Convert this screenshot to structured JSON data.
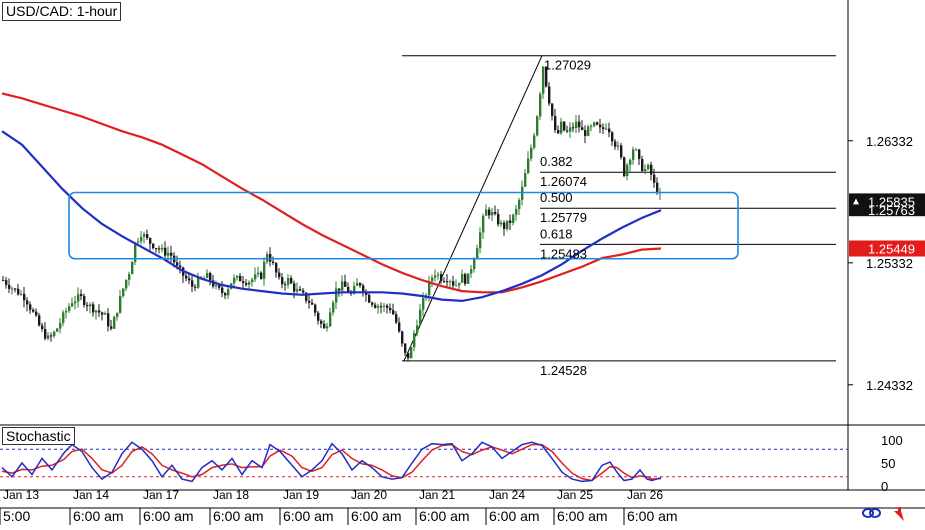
{
  "window": {
    "title": "USD/CAD: 1-hour"
  },
  "stochastic_label": "Stochastic",
  "colors": {
    "candle_up": "#2e7d2e",
    "candle_down": "#1a1a1a",
    "ma_fast": "#1f2fc4",
    "ma_slow": "#e02020",
    "zone": "#1e88e5",
    "price_tag": "#e21b1b",
    "stoch_k": "#1f2fc4",
    "stoch_d": "#e02020",
    "stoch_levels": "#1f2fc4"
  },
  "chart_data": [
    {
      "type": "candlestick",
      "title": "USD/CAD: 1-hour",
      "ylim": [
        1.2406,
        1.2742
      ],
      "y_ticks": [
        "1.26332",
        "1.25332",
        "1.24332"
      ],
      "price_tags": [
        {
          "label": "1.25835",
          "style": "dark",
          "value": 1.25835
        },
        {
          "label": "1.25763",
          "style": "dark-partial",
          "value": 1.25763
        },
        {
          "label": "1.25449",
          "style": "red",
          "value": 1.25449
        }
      ],
      "fib_levels": [
        {
          "ratio": "",
          "value": 1.27029,
          "label": "1.27029"
        },
        {
          "ratio": "0.382",
          "value": 1.26074,
          "label": "1.26074"
        },
        {
          "ratio": "0.500",
          "value": 1.25779,
          "label": "1.25779"
        },
        {
          "ratio": "0.618",
          "value": 1.25483,
          "label": "1.25483"
        },
        {
          "ratio": "",
          "value": 1.24528,
          "label": "1.24528"
        }
      ],
      "support_zone": {
        "from_date": "Jan 13 22:00",
        "to_date": "Jan 26 03:00",
        "low": 1.25365,
        "high": 1.25908
      },
      "swing_line": {
        "from": 1.24528,
        "to": 1.27029
      },
      "x_labels": [
        {
          "date": "Jan 13",
          "time": "5:00"
        },
        {
          "date": "Jan 14",
          "time": "6:00 am"
        },
        {
          "date": "Jan 17",
          "time": "6:00 am"
        },
        {
          "date": "Jan 18",
          "time": "6:00 am"
        },
        {
          "date": "Jan 19",
          "time": "6:00 am"
        },
        {
          "date": "Jan 20",
          "time": "6:00 am"
        },
        {
          "date": "Jan 21",
          "time": "6:00 am"
        },
        {
          "date": "Jan 24",
          "time": "6:00 am"
        },
        {
          "date": "Jan 25",
          "time": "6:00 am"
        },
        {
          "date": "Jan 26",
          "time": "6:00 am"
        }
      ],
      "price_path": [
        [
          0,
          1.2519
        ],
        [
          10,
          1.2512
        ],
        [
          22,
          1.2505
        ],
        [
          30,
          1.2492
        ],
        [
          38,
          1.2478
        ],
        [
          46,
          1.247
        ],
        [
          53,
          1.2478
        ],
        [
          61,
          1.2491
        ],
        [
          69,
          1.2502
        ],
        [
          77,
          1.2505
        ],
        [
          86,
          1.2498
        ],
        [
          94,
          1.2494
        ],
        [
          102,
          1.2489
        ],
        [
          108,
          1.2478
        ],
        [
          115,
          1.2498
        ],
        [
          121,
          1.2515
        ],
        [
          127,
          1.2528
        ],
        [
          132,
          1.2549
        ],
        [
          138,
          1.2558
        ],
        [
          145,
          1.2551
        ],
        [
          152,
          1.2547
        ],
        [
          160,
          1.2542
        ],
        [
          167,
          1.2541
        ],
        [
          174,
          1.2529
        ],
        [
          181,
          1.2522
        ],
        [
          189,
          1.2514
        ],
        [
          197,
          1.2519
        ],
        [
          205,
          1.2522
        ],
        [
          213,
          1.2512
        ],
        [
          221,
          1.2508
        ],
        [
          229,
          1.2519
        ],
        [
          237,
          1.252
        ],
        [
          245,
          1.2518
        ],
        [
          252,
          1.2521
        ],
        [
          258,
          1.2523
        ],
        [
          264,
          1.2542
        ],
        [
          270,
          1.2531
        ],
        [
          277,
          1.2516
        ],
        [
          285,
          1.2519
        ],
        [
          292,
          1.2511
        ],
        [
          300,
          1.2506
        ],
        [
          308,
          1.25
        ],
        [
          315,
          1.2487
        ],
        [
          322,
          1.2477
        ],
        [
          327,
          1.2496
        ],
        [
          333,
          1.2511
        ],
        [
          340,
          1.2515
        ],
        [
          348,
          1.2507
        ],
        [
          356,
          1.2518
        ],
        [
          364,
          1.2505
        ],
        [
          372,
          1.2499
        ],
        [
          380,
          1.2497
        ],
        [
          388,
          1.2496
        ],
        [
          394,
          1.2482
        ],
        [
          398,
          1.2468
        ],
        [
          403,
          1.2455
        ],
        [
          407,
          1.2458
        ],
        [
          412,
          1.248
        ],
        [
          418,
          1.2496
        ],
        [
          424,
          1.2511
        ],
        [
          431,
          1.2526
        ],
        [
          438,
          1.2521
        ],
        [
          446,
          1.2521
        ],
        [
          452,
          1.2514
        ],
        [
          458,
          1.2522
        ],
        [
          464,
          1.2518
        ],
        [
          470,
          1.2536
        ],
        [
          476,
          1.2554
        ],
        [
          482,
          1.2576
        ],
        [
          488,
          1.2574
        ],
        [
          494,
          1.2568
        ],
        [
          500,
          1.2562
        ],
        [
          506,
          1.2566
        ],
        [
          512,
          1.2573
        ],
        [
          518,
          1.259
        ],
        [
          524,
          1.2613
        ],
        [
          530,
          1.2635
        ],
        [
          535,
          1.266
        ],
        [
          540,
          1.2695
        ],
        [
          544,
          1.2675
        ],
        [
          548,
          1.2658
        ],
        [
          553,
          1.2635
        ],
        [
          558,
          1.2646
        ],
        [
          563,
          1.2639
        ],
        [
          568,
          1.2643
        ],
        [
          574,
          1.2648
        ],
        [
          580,
          1.2639
        ],
        [
          586,
          1.2642
        ],
        [
          592,
          1.2646
        ],
        [
          598,
          1.2641
        ],
        [
          604,
          1.2647
        ],
        [
          610,
          1.2634
        ],
        [
          616,
          1.2625
        ],
        [
          621,
          1.2607
        ],
        [
          626,
          1.2619
        ],
        [
          631,
          1.2629
        ],
        [
          636,
          1.2615
        ],
        [
          641,
          1.2609
        ],
        [
          646,
          1.2611
        ],
        [
          651,
          1.2597
        ],
        [
          655,
          1.2592
        ],
        [
          659,
          1.25835
        ]
      ],
      "ma_fast": [
        [
          0,
          1.2641
        ],
        [
          20,
          1.263
        ],
        [
          40,
          1.2612
        ],
        [
          60,
          1.2594
        ],
        [
          80,
          1.2578
        ],
        [
          100,
          1.2565
        ],
        [
          120,
          1.2555
        ],
        [
          140,
          1.2546
        ],
        [
          160,
          1.2537
        ],
        [
          180,
          1.2527
        ],
        [
          200,
          1.252
        ],
        [
          220,
          1.2515
        ],
        [
          240,
          1.2512
        ],
        [
          260,
          1.251
        ],
        [
          280,
          1.2508
        ],
        [
          300,
          1.2507
        ],
        [
          320,
          1.2508
        ],
        [
          340,
          1.2509
        ],
        [
          360,
          1.2509
        ],
        [
          380,
          1.2509
        ],
        [
          400,
          1.2508
        ],
        [
          420,
          1.2506
        ],
        [
          440,
          1.2503
        ],
        [
          460,
          1.2502
        ],
        [
          480,
          1.2505
        ],
        [
          500,
          1.251
        ],
        [
          520,
          1.2516
        ],
        [
          540,
          1.2523
        ],
        [
          560,
          1.2532
        ],
        [
          580,
          1.2543
        ],
        [
          600,
          1.2553
        ],
        [
          620,
          1.2562
        ],
        [
          640,
          1.257
        ],
        [
          659,
          1.25763
        ]
      ],
      "ma_slow": [
        [
          0,
          1.2672
        ],
        [
          20,
          1.2668
        ],
        [
          40,
          1.2663
        ],
        [
          60,
          1.2658
        ],
        [
          80,
          1.2653
        ],
        [
          100,
          1.2647
        ],
        [
          120,
          1.2641
        ],
        [
          140,
          1.2636
        ],
        [
          160,
          1.263
        ],
        [
          180,
          1.2622
        ],
        [
          200,
          1.2614
        ],
        [
          220,
          1.2604
        ],
        [
          240,
          1.2594
        ],
        [
          260,
          1.2585
        ],
        [
          280,
          1.2575
        ],
        [
          300,
          1.2565
        ],
        [
          320,
          1.2556
        ],
        [
          340,
          1.2548
        ],
        [
          360,
          1.254
        ],
        [
          380,
          1.2532
        ],
        [
          400,
          1.2525
        ],
        [
          420,
          1.2519
        ],
        [
          440,
          1.2514
        ],
        [
          460,
          1.251
        ],
        [
          480,
          1.2509
        ],
        [
          500,
          1.2509
        ],
        [
          520,
          1.2513
        ],
        [
          540,
          1.2518
        ],
        [
          560,
          1.2524
        ],
        [
          580,
          1.253
        ],
        [
          600,
          1.2537
        ],
        [
          620,
          1.254
        ],
        [
          640,
          1.2544
        ],
        [
          659,
          1.25449
        ]
      ]
    },
    {
      "type": "line",
      "title": "Stochastic",
      "ylim": [
        0,
        100
      ],
      "y_ticks": [
        "100",
        "50",
        "0"
      ],
      "levels": [
        80,
        20
      ],
      "k": [
        [
          0,
          40
        ],
        [
          10,
          20
        ],
        [
          20,
          50
        ],
        [
          30,
          25
        ],
        [
          40,
          60
        ],
        [
          50,
          35
        ],
        [
          62,
          72
        ],
        [
          70,
          90
        ],
        [
          80,
          75
        ],
        [
          90,
          40
        ],
        [
          100,
          15
        ],
        [
          110,
          30
        ],
        [
          120,
          70
        ],
        [
          130,
          95
        ],
        [
          140,
          80
        ],
        [
          150,
          55
        ],
        [
          160,
          20
        ],
        [
          170,
          45
        ],
        [
          180,
          15
        ],
        [
          190,
          10
        ],
        [
          200,
          40
        ],
        [
          210,
          55
        ],
        [
          220,
          35
        ],
        [
          230,
          60
        ],
        [
          240,
          25
        ],
        [
          250,
          55
        ],
        [
          260,
          40
        ],
        [
          268,
          90
        ],
        [
          278,
          75
        ],
        [
          290,
          45
        ],
        [
          300,
          20
        ],
        [
          310,
          35
        ],
        [
          320,
          55
        ],
        [
          330,
          92
        ],
        [
          340,
          70
        ],
        [
          350,
          35
        ],
        [
          360,
          55
        ],
        [
          370,
          40
        ],
        [
          380,
          20
        ],
        [
          390,
          15
        ],
        [
          400,
          18
        ],
        [
          410,
          50
        ],
        [
          420,
          80
        ],
        [
          430,
          92
        ],
        [
          440,
          90
        ],
        [
          450,
          92
        ],
        [
          460,
          55
        ],
        [
          470,
          70
        ],
        [
          480,
          95
        ],
        [
          490,
          85
        ],
        [
          500,
          60
        ],
        [
          510,
          75
        ],
        [
          520,
          90
        ],
        [
          530,
          95
        ],
        [
          540,
          88
        ],
        [
          550,
          60
        ],
        [
          560,
          30
        ],
        [
          570,
          15
        ],
        [
          580,
          10
        ],
        [
          590,
          12
        ],
        [
          600,
          45
        ],
        [
          608,
          52
        ],
        [
          615,
          30
        ],
        [
          622,
          12
        ],
        [
          630,
          15
        ],
        [
          638,
          35
        ],
        [
          645,
          15
        ],
        [
          650,
          12
        ],
        [
          659,
          18
        ]
      ],
      "d": [
        [
          0,
          32
        ],
        [
          10,
          28
        ],
        [
          20,
          36
        ],
        [
          30,
          35
        ],
        [
          40,
          43
        ],
        [
          50,
          45
        ],
        [
          62,
          58
        ],
        [
          70,
          75
        ],
        [
          80,
          80
        ],
        [
          90,
          60
        ],
        [
          100,
          35
        ],
        [
          110,
          28
        ],
        [
          120,
          45
        ],
        [
          130,
          75
        ],
        [
          140,
          85
        ],
        [
          150,
          70
        ],
        [
          160,
          45
        ],
        [
          170,
          35
        ],
        [
          180,
          28
        ],
        [
          190,
          20
        ],
        [
          200,
          25
        ],
        [
          210,
          40
        ],
        [
          220,
          45
        ],
        [
          230,
          48
        ],
        [
          240,
          40
        ],
        [
          250,
          42
        ],
        [
          260,
          42
        ],
        [
          268,
          65
        ],
        [
          278,
          78
        ],
        [
          290,
          65
        ],
        [
          300,
          40
        ],
        [
          310,
          32
        ],
        [
          320,
          40
        ],
        [
          330,
          68
        ],
        [
          340,
          78
        ],
        [
          350,
          60
        ],
        [
          360,
          48
        ],
        [
          370,
          45
        ],
        [
          380,
          35
        ],
        [
          390,
          22
        ],
        [
          400,
          18
        ],
        [
          410,
          30
        ],
        [
          420,
          55
        ],
        [
          430,
          78
        ],
        [
          440,
          88
        ],
        [
          450,
          90
        ],
        [
          460,
          75
        ],
        [
          470,
          68
        ],
        [
          480,
          78
        ],
        [
          490,
          85
        ],
        [
          500,
          78
        ],
        [
          510,
          70
        ],
        [
          520,
          80
        ],
        [
          530,
          90
        ],
        [
          540,
          90
        ],
        [
          550,
          75
        ],
        [
          560,
          50
        ],
        [
          570,
          28
        ],
        [
          580,
          16
        ],
        [
          590,
          12
        ],
        [
          600,
          28
        ],
        [
          608,
          42
        ],
        [
          615,
          40
        ],
        [
          622,
          28
        ],
        [
          630,
          18
        ],
        [
          638,
          22
        ],
        [
          645,
          20
        ],
        [
          650,
          15
        ],
        [
          659,
          16
        ]
      ]
    }
  ]
}
